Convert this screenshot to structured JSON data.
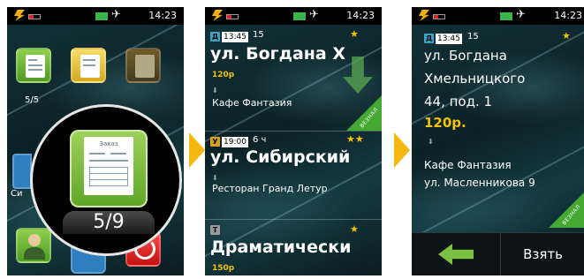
{
  "status": {
    "time": "14:23"
  },
  "screen1": {
    "tiles": [
      {
        "label": "5/5"
      },
      {
        "label": ""
      },
      {
        "label": ""
      }
    ],
    "partial_label": "Си",
    "zoom": {
      "doc_title": "Заказ",
      "count": "5/9"
    }
  },
  "screen2": {
    "orders": [
      {
        "type_badge": "Д",
        "time": "13:45",
        "meta": "15",
        "stars": "★",
        "street": "ул. Богдана Х",
        "price": "120р",
        "destination": "Кафе Фантазия",
        "ribbon": "ВЕЗНАЛ"
      },
      {
        "type_badge": "У",
        "time": "19:00",
        "meta": "6 ч",
        "stars": "★★",
        "street": "ул. Сибирский",
        "price": "",
        "destination": "Ресторан Гранд Летур",
        "ribbon": ""
      },
      {
        "type_badge": "Т",
        "time": "",
        "meta": "",
        "stars": "★",
        "street": "Драматически",
        "price": "150р",
        "destination": "",
        "ribbon": ""
      }
    ]
  },
  "screen3": {
    "type_badge": "Д",
    "time": "13:45",
    "meta": "15",
    "stars": "★",
    "address_lines": [
      "ул. Богдана",
      "Хмельницкого",
      "44, под. 1"
    ],
    "price": "120р.",
    "destination_lines": [
      "Кафе Фантазия",
      "ул. Масленникова 9"
    ],
    "ribbon": "ВЕЗНАЛ",
    "take_label": "Взять"
  },
  "colors": {
    "accent_yellow": "#f7b70c",
    "green": "#44a833",
    "badge_blue": "#3aa5c8",
    "badge_gold": "#d9a21a",
    "badge_gray": "#9a9a9a"
  }
}
